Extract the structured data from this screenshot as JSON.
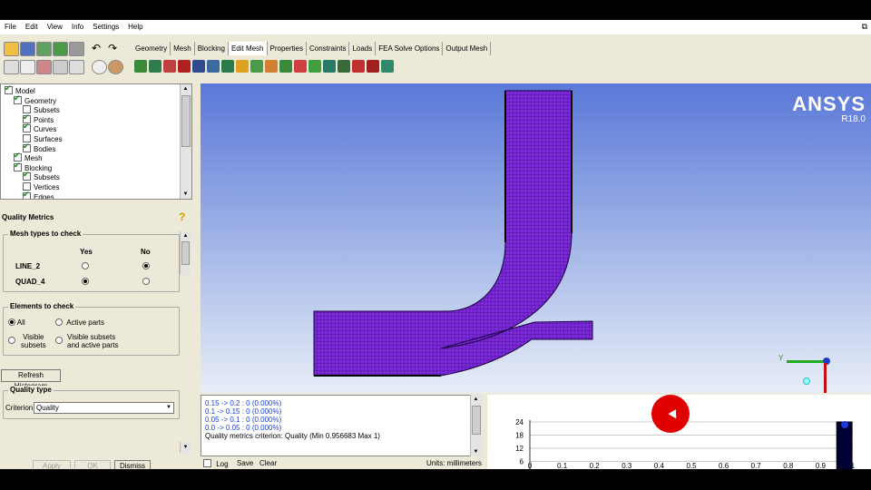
{
  "menu": [
    "File",
    "Edit",
    "View",
    "Info",
    "Settings",
    "Help"
  ],
  "tabs": [
    "Geometry",
    "Mesh",
    "Blocking",
    "Edit Mesh",
    "Properties",
    "Constraints",
    "Loads",
    "FEA Solve Options",
    "Output Mesh"
  ],
  "active_tab": "Edit Mesh",
  "tree": [
    {
      "label": "Model",
      "checked": true,
      "indent": 0
    },
    {
      "label": "Geometry",
      "checked": true,
      "indent": 1
    },
    {
      "label": "Subsets",
      "checked": false,
      "indent": 2
    },
    {
      "label": "Points",
      "checked": true,
      "indent": 2
    },
    {
      "label": "Curves",
      "checked": true,
      "indent": 2
    },
    {
      "label": "Surfaces",
      "checked": false,
      "indent": 2
    },
    {
      "label": "Bodies",
      "checked": true,
      "indent": 2
    },
    {
      "label": "Mesh",
      "checked": true,
      "indent": 1
    },
    {
      "label": "Blocking",
      "checked": true,
      "indent": 1
    },
    {
      "label": "Subsets",
      "checked": true,
      "indent": 2
    },
    {
      "label": "Vertices",
      "checked": false,
      "indent": 2
    },
    {
      "label": "Edges",
      "checked": true,
      "indent": 2
    }
  ],
  "panel": {
    "title": "Quality Metrics",
    "mesh_types_label": "Mesh types to check",
    "yes": "Yes",
    "no": "No",
    "types": [
      {
        "name": "LINE_2",
        "selected": "no"
      },
      {
        "name": "QUAD_4",
        "selected": "yes"
      }
    ],
    "elements_label": "Elements to check",
    "opt_all": "All",
    "opt_active": "Active parts",
    "opt_visible_1": "Visible",
    "opt_visible_2": "subsets",
    "opt_visible_active_1": "Visible subsets",
    "opt_visible_active_2": "and active parts",
    "refresh": "Refresh Histogram",
    "quality_type_label": "Quality type",
    "criterion_label": "Criterion",
    "criterion_value": "Quality",
    "apply": "Apply",
    "ok": "OK",
    "dismiss": "Dismiss"
  },
  "brand": {
    "name": "ANSYS",
    "version": "R18.0"
  },
  "axis_label": "Y",
  "messages": [
    "0.15 -> 0.2 : 0 (0.000%)",
    "0.1 -> 0.15 : 0 (0.000%)",
    "0.05 -> 0.1 : 0 (0.000%)",
    "0.0 -> 0.05 : 0 (0.000%)",
    "Quality metrics criterion: Quality (Min 0.956683 Max 1)"
  ],
  "bottom": {
    "log": "Log",
    "save": "Save",
    "clear": "Clear",
    "units": "Units: millimeters"
  },
  "colors": {
    "mesh": "#7a2bd6",
    "viewport_top": "#5a78d8",
    "bar": "#000033",
    "cursor_dot": "#e00000"
  },
  "chart_data": {
    "type": "bar",
    "x_ticks": [
      "0",
      "0.1",
      "0.2",
      "0.3",
      "0.4",
      "0.5",
      "0.6",
      "0.7",
      "0.8",
      "0.9",
      "1"
    ],
    "y_ticks": [
      "24",
      "18",
      "12",
      "6",
      "0"
    ],
    "ylim": [
      0,
      24
    ],
    "xlim": [
      0,
      1
    ],
    "bars": [
      {
        "x0": 0.95,
        "x1": 1.0,
        "value": 24
      }
    ],
    "grid": true
  }
}
